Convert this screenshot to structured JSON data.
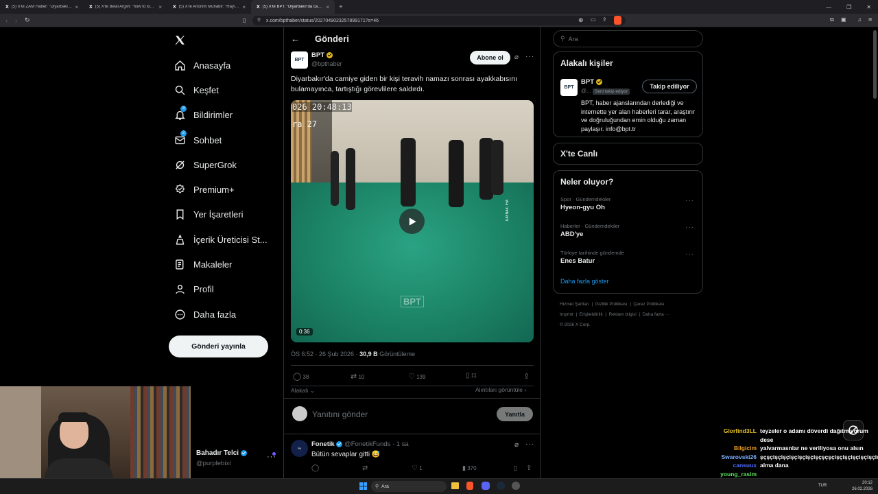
{
  "browser": {
    "tabs": [
      {
        "label": "(5) X'te ZAM Haber: \"Diyarbakır'da h...",
        "active": false
      },
      {
        "label": "(5) X'te Belal Argivi: \"how to lose a g...",
        "active": false
      },
      {
        "label": "(5) X'te Anonim Muhabir: \"Hayır süt...",
        "active": false
      },
      {
        "label": "(5) X'te BPT: \"Diyarbakır'da cami...",
        "active": true
      }
    ],
    "url": "x.com/bpthaber/status/2027049023257899171?s=46"
  },
  "nav": {
    "items": [
      {
        "key": "home",
        "label": "Anasayfa"
      },
      {
        "key": "explore",
        "label": "Keşfet"
      },
      {
        "key": "notifications",
        "label": "Bildirimler",
        "badge": "3"
      },
      {
        "key": "chat",
        "label": "Sohbet",
        "badge": "2"
      },
      {
        "key": "grok",
        "label": "SuperGrok"
      },
      {
        "key": "premium",
        "label": "Premium+"
      },
      {
        "key": "bookmarks",
        "label": "Yer İşaretleri"
      },
      {
        "key": "creator",
        "label": "İçerik Üreticisi St..."
      },
      {
        "key": "articles",
        "label": "Makaleler"
      },
      {
        "key": "profile",
        "label": "Profil"
      },
      {
        "key": "more",
        "label": "Daha fazla"
      }
    ],
    "post_button": "Gönderi yayınla",
    "account": {
      "name": "Bahadır Telci",
      "handle": "@purplebixi"
    }
  },
  "post": {
    "header_title": "Gönderi",
    "author": {
      "name": "BPT",
      "handle": "@bpthaber",
      "avatar": "BPT"
    },
    "subscribe_label": "Abone ol",
    "text": "Diyarbakır'da camiye giden bir kişi teravih namazı sonrası ayakkabısını bulamayınca, tartıştığı görevlilere saldırdı.",
    "video": {
      "overlay_timestamp": "026 20:48:13",
      "overlay_line2": "ra 27",
      "watermark": "KAYNAK: İHA",
      "duration": "0:36",
      "logo": "BPT"
    },
    "meta": {
      "time": "ÖS 6:52 · 26 Şub 2026 · ",
      "views": "30,9 B",
      "views_label": " Görüntüleme"
    },
    "stats": {
      "replies": "38",
      "reposts": "10",
      "likes": "139",
      "bookmarks": "11"
    },
    "sort_label": "Alakalı",
    "quotes_label": "Alıntıları görüntüle",
    "reply_placeholder": "Yanıtını gönder",
    "reply_button": "Yanıtla"
  },
  "reply": {
    "name": "Fonetik",
    "handle": "@FonetikFunds · 1 sa",
    "text": "Bütün sevaplar gitti 😅",
    "stats": {
      "likes": "1",
      "views": "370"
    }
  },
  "sidebar": {
    "search_placeholder": "Ara",
    "related": {
      "title": "Alakalı kişiler",
      "name": "BPT",
      "handle": "@...",
      "follows_you": "Seni takip ediyor",
      "follow_button": "Takip ediliyor",
      "bio": "BPT, haber ajanslarından derlediği ve internette yer alan haberleri tarar, araştırır ve doğruluğundan emin olduğu zaman paylaşır. info@bpt.tr"
    },
    "live_title": "X'te Canlı",
    "trends": {
      "title": "Neler oluyor?",
      "items": [
        {
          "context": "Spor · Gündemdekiler",
          "name": "Hyeon-gyu Oh"
        },
        {
          "context": "Haberler · Gündemdekiler",
          "name": "ABD'ye"
        },
        {
          "context": "Türkiye tarihinde gündemde",
          "name": "Enes Batur"
        }
      ],
      "show_more": "Daha fazla göster"
    },
    "footer": {
      "line1": [
        "Hizmet Şartları",
        "Gizlilik Politikası",
        "Çerez Politikası"
      ],
      "line2": [
        "Imprint",
        "Erişilebilirlik",
        "Reklam bilgisi",
        "Daha fazla ···"
      ],
      "copyright": "© 2026 X Corp."
    }
  },
  "stream_chat": [
    {
      "user": "Glorfind3LL",
      "color": "#e6c229",
      "msg": "teyzeler o adamı döverdi dağıtmıyorum dese"
    },
    {
      "user": "Bilgicim",
      "color": "#f0a020",
      "msg": "yalvarmasnlar ne veriliyosa onu alsın"
    },
    {
      "user": "Swarovski26",
      "color": "#7fb0ff",
      "msg": "şçşçişçişçişçişçişçişçşçşçişçişçişçişçişçişçişçişçişçişç"
    },
    {
      "user": "cansuux",
      "color": "#4f6cff",
      "msg": "alma dana"
    },
    {
      "user": "young_rasim",
      "color": "#5ce65c",
      "msg": ""
    }
  ],
  "taskbar": {
    "search": "Ara",
    "lang": "TUR",
    "time": "20:12",
    "date": "26.02.2026"
  },
  "colors": {
    "accent": "#1d9bf0",
    "verified_gold": "#e2b719",
    "background": "#000000",
    "video_floor": "#1f8a72"
  }
}
